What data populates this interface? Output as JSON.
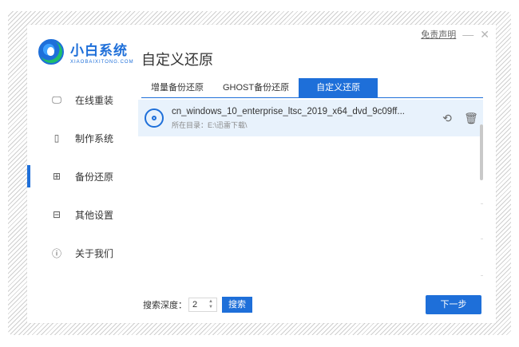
{
  "window": {
    "disclaimer": "免责声明",
    "minimize_glyph": "—",
    "close_glyph": "✕"
  },
  "logo": {
    "title": "小白系统",
    "subtitle": "XIAOBAIXITONG.COM"
  },
  "page_title": "自定义还原",
  "sidebar": {
    "items": [
      {
        "label": "在线重装",
        "icon": "monitor-icon",
        "glyph": "🖵",
        "active": false
      },
      {
        "label": "制作系统",
        "icon": "usb-icon",
        "glyph": "▯",
        "active": false
      },
      {
        "label": "备份还原",
        "icon": "grid-icon",
        "glyph": "⊞",
        "active": true
      },
      {
        "label": "其他设置",
        "icon": "toolbox-icon",
        "glyph": "⊟",
        "active": false
      },
      {
        "label": "关于我们",
        "icon": "info-icon",
        "glyph": "ⓘ",
        "active": false
      }
    ]
  },
  "tabs": [
    {
      "label": "增量备份还原",
      "active": false
    },
    {
      "label": "GHOST备份还原",
      "active": false
    },
    {
      "label": "自定义还原",
      "active": true
    }
  ],
  "file": {
    "name": "cn_windows_10_enterprise_ltsc_2019_x64_dvd_9c09ff...",
    "dir": "所在目录：E:\\迅雷下载\\",
    "restore_icon": "restore-icon",
    "restore_glyph": "⟲",
    "delete_icon": "trash-icon",
    "delete_glyph": "🗑"
  },
  "footer": {
    "depth_label": "搜索深度：",
    "depth_value": "2",
    "search_label": "搜索",
    "next_label": "下一步"
  },
  "colors": {
    "accent": "#1e6fd9",
    "row_highlight": "#e8f2fc"
  }
}
